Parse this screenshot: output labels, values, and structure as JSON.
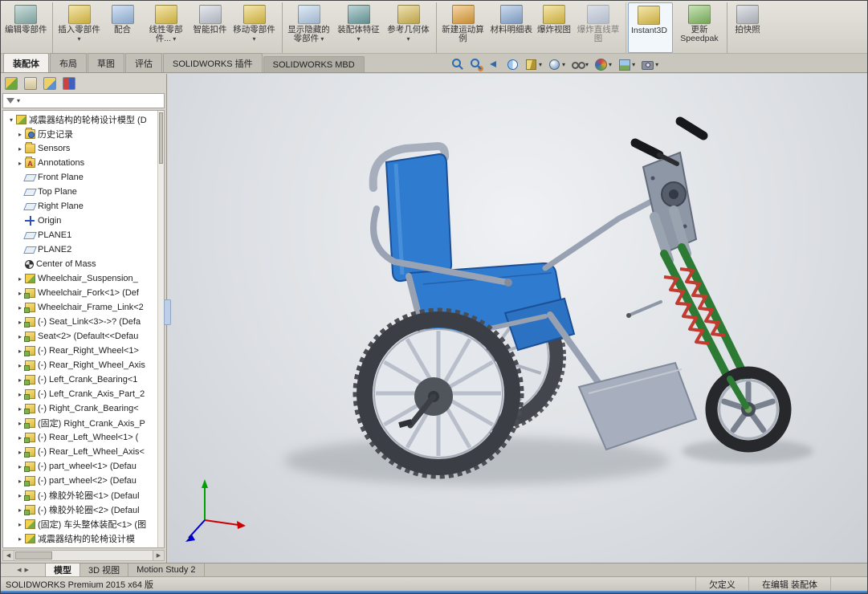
{
  "colors": {
    "seat": "#2e7bd0",
    "seat_dark": "#1c4f96",
    "fork": "#2c7a34",
    "spring": "#c23b2e",
    "frame": "#9aa3b3",
    "tire": "#3b3e44",
    "rim": "#e4e7ec",
    "origin_x": "#cc0000",
    "origin_y": "#00a000",
    "origin_z": "#0000cc"
  },
  "ribbon": {
    "buttons": [
      {
        "label": "编辑零部件",
        "icon": "edit-component",
        "color": "#8fb8b4",
        "sep": true
      },
      {
        "label": "插入零部件",
        "icon": "insert-components",
        "color": "#e8c849",
        "dropdown": true
      },
      {
        "label": "配合",
        "icon": "mate",
        "color": "#9fc0e8"
      },
      {
        "label": "线性零部件...",
        "icon": "linear-component-pattern",
        "color": "#e8c849",
        "dropdown": true
      },
      {
        "label": "智能扣件",
        "icon": "smart-fasteners",
        "color": "#c8cdd8"
      },
      {
        "label": "移动零部件",
        "icon": "move-component",
        "color": "#e8c849",
        "dropdown": true,
        "sep": true
      },
      {
        "label": "显示隐藏的零部件",
        "icon": "show-hidden-components",
        "color": "#b9d2ec",
        "dropdown": true
      },
      {
        "label": "装配体特征",
        "icon": "assembly-features",
        "color": "#6fa3a6",
        "dropdown": true
      },
      {
        "label": "参考几何体",
        "icon": "reference-geometry",
        "color": "#d9bd55",
        "dropdown": true,
        "sep": true
      },
      {
        "label": "新建运动算例",
        "icon": "new-motion-study",
        "color": "#e8a33a"
      },
      {
        "label": "材料明细表",
        "icon": "bill-of-materials",
        "color": "#8fb0dc"
      },
      {
        "label": "爆炸视图",
        "icon": "exploded-view",
        "color": "#e8c849"
      },
      {
        "label": "爆炸直线草图",
        "icon": "explode-line-sketch",
        "color": "#a8bce6",
        "disabled": true,
        "sep": true
      },
      {
        "label": "Instant3D",
        "icon": "instant3d",
        "color": "#e8c849",
        "active": true,
        "sep": true
      },
      {
        "label": "更新 Speedpak",
        "icon": "update-speedpak",
        "color": "#86c063",
        "sep": true
      },
      {
        "label": "拍快照",
        "icon": "take-snapshot",
        "color": "#c0c5ce"
      }
    ]
  },
  "tabstrip": {
    "tabs": [
      {
        "label": "装配体",
        "active": true
      },
      {
        "label": "布局"
      },
      {
        "label": "草图"
      },
      {
        "label": "评估"
      },
      {
        "label": "SOLIDWORKS 插件"
      },
      {
        "label": "SOLIDWORKS MBD",
        "state": "dark"
      }
    ]
  },
  "viewbar": {
    "items": [
      {
        "icon": "zoom-fit"
      },
      {
        "icon": "zoom-area"
      },
      {
        "icon": "previous-view"
      },
      {
        "icon": "section-view"
      },
      {
        "icon": "view-orientation",
        "dropdown": true
      },
      {
        "icon": "display-style",
        "dropdown": true
      },
      {
        "icon": "hide-show-items",
        "dropdown": true
      },
      {
        "icon": "edit-appearance",
        "dropdown": true
      },
      {
        "icon": "apply-scene",
        "dropdown": true
      },
      {
        "icon": "view-settings",
        "dropdown": true
      }
    ]
  },
  "panel": {
    "tabs": [
      {
        "icon": "featuremanager-tree"
      },
      {
        "icon": "property-manager"
      },
      {
        "icon": "configuration-manager"
      },
      {
        "icon": "dimxpert-manager"
      }
    ],
    "overflow": "»"
  },
  "tree": {
    "items": [
      {
        "icon": "asm",
        "state": "expanded",
        "level": 0,
        "label": "减震器结构的轮椅设计模型 (D"
      },
      {
        "icon": "folder-history",
        "state": "collapsed",
        "level": 1,
        "label": "历史记录"
      },
      {
        "icon": "folder-sensors",
        "state": "collapsed",
        "level": 1,
        "label": "Sensors"
      },
      {
        "icon": "folder-annotations",
        "state": "collapsed",
        "level": 1,
        "label": "Annotations"
      },
      {
        "icon": "plane",
        "level": 1,
        "label": "Front Plane"
      },
      {
        "icon": "plane",
        "level": 1,
        "label": "Top Plane"
      },
      {
        "icon": "plane",
        "level": 1,
        "label": "Right Plane"
      },
      {
        "icon": "origin",
        "level": 1,
        "label": "Origin"
      },
      {
        "icon": "plane",
        "level": 1,
        "label": "PLANE1"
      },
      {
        "icon": "plane",
        "level": 1,
        "label": "PLANE2"
      },
      {
        "icon": "com",
        "level": 1,
        "label": "Center of Mass"
      },
      {
        "icon": "subasm",
        "state": "collapsed",
        "level": 1,
        "label": "Wheelchair_Suspension_"
      },
      {
        "icon": "part",
        "state": "collapsed",
        "level": 1,
        "label": "Wheelchair_Fork<1> (Def"
      },
      {
        "icon": "part",
        "state": "collapsed",
        "level": 1,
        "label": "Wheelchair_Frame_Link<2"
      },
      {
        "icon": "part",
        "state": "collapsed",
        "level": 1,
        "label": "(-) Seat_Link<3>->? (Defa"
      },
      {
        "icon": "part",
        "state": "collapsed",
        "level": 1,
        "label": "Seat<2> (Default<<Defau"
      },
      {
        "icon": "part",
        "state": "collapsed",
        "level": 1,
        "label": "(-) Rear_Right_Wheel<1>"
      },
      {
        "icon": "part",
        "state": "collapsed",
        "level": 1,
        "label": "(-) Rear_Right_Wheel_Axis"
      },
      {
        "icon": "part",
        "state": "collapsed",
        "level": 1,
        "label": "(-) Left_Crank_Bearing<1"
      },
      {
        "icon": "part",
        "state": "collapsed",
        "level": 1,
        "label": "(-) Left_Crank_Axis_Part_2"
      },
      {
        "icon": "part",
        "state": "collapsed",
        "level": 1,
        "label": "(-) Right_Crank_Bearing<"
      },
      {
        "icon": "part",
        "state": "collapsed",
        "level": 1,
        "label": "(固定) Right_Crank_Axis_P"
      },
      {
        "icon": "part",
        "state": "collapsed",
        "level": 1,
        "label": "(-) Rear_Left_Wheel<1> ("
      },
      {
        "icon": "part",
        "state": "collapsed",
        "level": 1,
        "label": "(-) Rear_Left_Wheel_Axis<"
      },
      {
        "icon": "part",
        "state": "collapsed",
        "level": 1,
        "label": "(-) part_wheel<1> (Defau"
      },
      {
        "icon": "part",
        "state": "collapsed",
        "level": 1,
        "label": "(-) part_wheel<2> (Defau"
      },
      {
        "icon": "part",
        "state": "collapsed",
        "level": 1,
        "label": "(-) 橡胶外轮圈<1> (Defaul"
      },
      {
        "icon": "part",
        "state": "collapsed",
        "level": 1,
        "label": "(-) 橡胶外轮圈<2> (Defaul"
      },
      {
        "icon": "subasm",
        "state": "collapsed",
        "level": 1,
        "label": "(固定) 车头整体装配<1> (图"
      },
      {
        "icon": "asm",
        "state": "collapsed",
        "level": 1,
        "label": "减震器结构的轮椅设计模"
      }
    ]
  },
  "bottom": {
    "tabs": [
      {
        "label": "模型",
        "active": true
      },
      {
        "label": "3D 视图"
      },
      {
        "label": "Motion Study 2"
      }
    ]
  },
  "status": {
    "left": "SOLIDWORKS Premium 2015 x64 版",
    "items": [
      "欠定义",
      "在编辑 装配体"
    ]
  }
}
